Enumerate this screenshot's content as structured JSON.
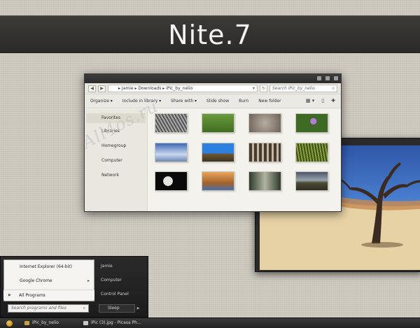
{
  "banner": {
    "title": "Nite.7"
  },
  "watermark": "All4os.ru",
  "explorer": {
    "breadcrumb": "▸ Jamie ▸ Downloads ▸ iPic_by_nelio",
    "search_placeholder": "Search iPic_by_nelio",
    "toolbar": [
      "Organize ▾",
      "Include in library ▾",
      "Share with ▾",
      "Slide show",
      "Burn",
      "New folder"
    ],
    "nav": [
      "Favorites",
      "Libraries",
      "Homegroup",
      "Computer",
      "Network"
    ],
    "thumb_count": 12
  },
  "start_menu": {
    "programs": [
      "Internet Explorer (64-bit)",
      "Google Chrome"
    ],
    "all_programs": "All Programs",
    "search_placeholder": "Search programs and files",
    "right_items": [
      "Jamie",
      "Computer",
      "Control Panel"
    ],
    "sleep": "Sleep"
  },
  "taskbar": {
    "items": [
      "iPic_by_nelio",
      "iPic (3).jpg - Picasa Ph..."
    ]
  }
}
